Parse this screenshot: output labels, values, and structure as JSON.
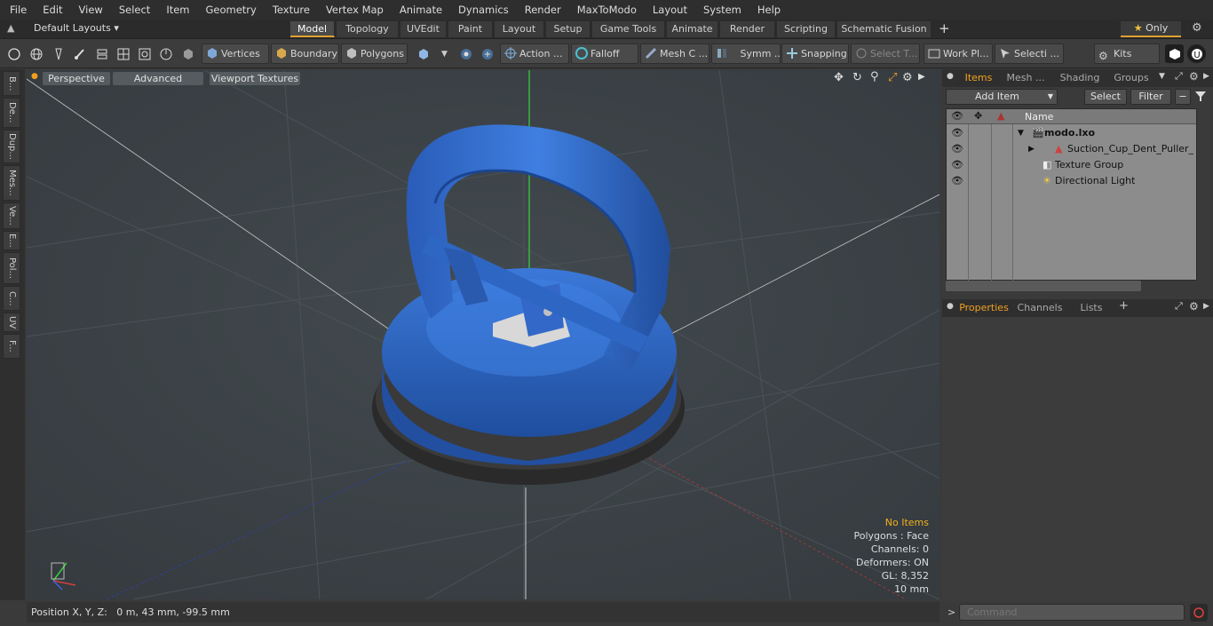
{
  "menu": [
    "File",
    "Edit",
    "View",
    "Select",
    "Item",
    "Geometry",
    "Texture",
    "Vertex Map",
    "Animate",
    "Dynamics",
    "Render",
    "MaxToModo",
    "Layout",
    "System",
    "Help"
  ],
  "layouts_label": "Default Layouts",
  "layout_tabs": [
    "Model",
    "Topology",
    "UVEdit",
    "Paint",
    "Layout",
    "Setup",
    "Game Tools",
    "Animate",
    "Render",
    "Scripting",
    "Schematic Fusion"
  ],
  "only_label": "Only",
  "toolbar": {
    "vertices": "Vertices",
    "boundary": "Boundary",
    "polygons": "Polygons",
    "action": "Action ...",
    "falloff": "Falloff",
    "mesh_c": "Mesh C ...",
    "symm": "Symm ...",
    "snapping": "Snapping",
    "select_t": "Select T...",
    "work_pl": "Work Pl...",
    "selecti": "Selecti ...",
    "kits": "Kits"
  },
  "left_tabs": [
    "B...",
    "De...",
    "Dup...",
    "Mes...",
    "Ve...",
    "E...",
    "Pol...",
    "C...",
    "UV",
    "F..."
  ],
  "viewport": {
    "view_mode": "Perspective",
    "shading": "Advanced",
    "textures": "Viewport Textures",
    "info": {
      "items": "No Items",
      "polygons": "Polygons : Face",
      "channels": "Channels: 0",
      "deformers": "Deformers: ON",
      "gl": "GL: 8,352",
      "scale": "10 mm"
    }
  },
  "status": {
    "position": "Position X, Y, Z:   0 m, 43 mm, -99.5 mm"
  },
  "items_panel": {
    "tabs": [
      "Items",
      "Mesh ...",
      "Shading",
      "Groups"
    ],
    "add_item": "Add Item",
    "select": "Select",
    "filter": "Filter",
    "name_header": "Name",
    "rows": [
      {
        "label": "modo.lxo"
      },
      {
        "label": "Suction_Cup_Dent_Puller_Fal..."
      },
      {
        "label": "Texture Group"
      },
      {
        "label": "Directional Light"
      }
    ]
  },
  "props_panel": {
    "tabs": [
      "Properties",
      "Channels",
      "Lists"
    ]
  },
  "command": {
    "placeholder": "Command"
  },
  "colors": {
    "accent": "#f0a020",
    "model_blue": "#2f6ad0",
    "viewport_bg": "#3b4145"
  }
}
